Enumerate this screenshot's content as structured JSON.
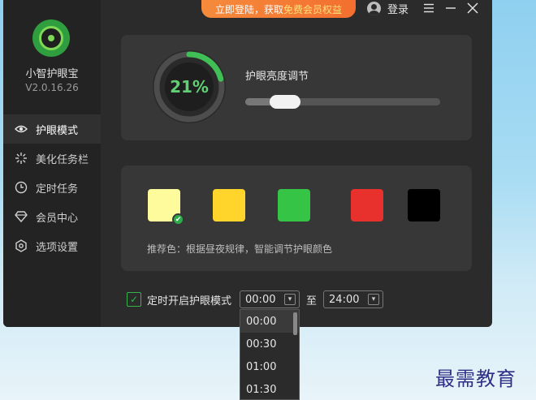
{
  "topbar": {
    "promo_prefix": "立即登陆，获取",
    "promo_highlight": "免费会员权益",
    "login_label": "登录",
    "menu_icon": "menu-icon",
    "minimize_icon": "minimize-icon",
    "close_icon": "close-icon"
  },
  "app": {
    "name": "小智护眼宝",
    "version": "V2.0.16.26"
  },
  "sidebar": {
    "items": [
      {
        "label": "护眼模式",
        "icon": "eye-icon",
        "active": true
      },
      {
        "label": "美化任务栏",
        "icon": "sparkle-icon",
        "active": false
      },
      {
        "label": "定时任务",
        "icon": "clock-icon",
        "active": false
      },
      {
        "label": "会员中心",
        "icon": "diamond-icon",
        "active": false
      },
      {
        "label": "选项设置",
        "icon": "settings-icon",
        "active": false
      }
    ]
  },
  "brightness": {
    "percent_text": "21%",
    "percent": 0.21,
    "title": "护眼亮度调节",
    "slider_level": 0.21
  },
  "colors": {
    "swatches": [
      "#fdfb9c",
      "#ffd52b",
      "#36c447",
      "#e8302c",
      "#000000"
    ],
    "selected_index": 0,
    "recommend_text": "推荐色：根据昼夜规律，智能调节护眼颜色"
  },
  "timer": {
    "checked": true,
    "label": "定时开启护眼模式",
    "start": "00:00",
    "separator": "至",
    "end": "24:00",
    "options": [
      "00:00",
      "00:30",
      "01:00",
      "01:30"
    ]
  },
  "watermark": "最需教育",
  "accent": "#3fbf55"
}
